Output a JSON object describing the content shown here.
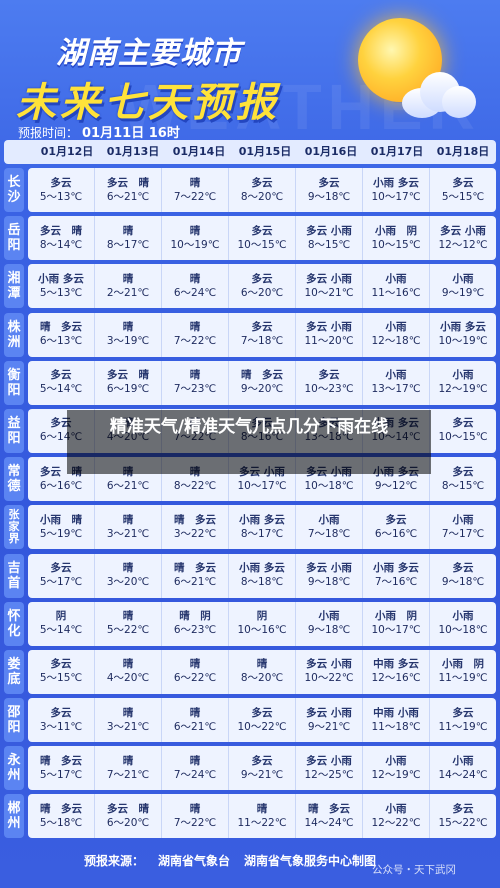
{
  "header": {
    "province": "湖南主要城市",
    "title": "未来七天预报",
    "bg_word": "WEATHER",
    "publish_label": "预报时间：",
    "publish_time": "01月11日 16时"
  },
  "dates": [
    "01月12日",
    "01月13日",
    "01月14日",
    "01月15日",
    "01月16日",
    "01月17日",
    "01月18日"
  ],
  "cities": [
    {
      "name": "长沙",
      "days": [
        {
          "c": "多云",
          "t": "5～13℃"
        },
        {
          "c": "多云　晴",
          "t": "6～21℃"
        },
        {
          "c": "晴",
          "t": "7～22℃"
        },
        {
          "c": "多云",
          "t": "8～20℃"
        },
        {
          "c": "多云",
          "t": "9～18℃"
        },
        {
          "c": "小雨 多云",
          "t": "10～17℃"
        },
        {
          "c": "多云",
          "t": "5～15℃"
        }
      ]
    },
    {
      "name": "岳阳",
      "days": [
        {
          "c": "多云　晴",
          "t": "8～14℃"
        },
        {
          "c": "晴",
          "t": "8～17℃"
        },
        {
          "c": "晴",
          "t": "10～19℃"
        },
        {
          "c": "多云",
          "t": "10～15℃"
        },
        {
          "c": "多云 小雨",
          "t": "8～15℃"
        },
        {
          "c": "小雨　阴",
          "t": "10～15℃"
        },
        {
          "c": "多云 小雨",
          "t": "12～12℃"
        }
      ]
    },
    {
      "name": "湘潭",
      "days": [
        {
          "c": "小雨 多云",
          "t": "5～13℃"
        },
        {
          "c": "晴",
          "t": "2～21℃"
        },
        {
          "c": "晴",
          "t": "6～24℃"
        },
        {
          "c": "多云",
          "t": "6～20℃"
        },
        {
          "c": "多云 小雨",
          "t": "10～21℃"
        },
        {
          "c": "小雨",
          "t": "11～16℃"
        },
        {
          "c": "小雨",
          "t": "9～19℃"
        }
      ]
    },
    {
      "name": "株洲",
      "days": [
        {
          "c": "晴　多云",
          "t": "6～13℃"
        },
        {
          "c": "晴",
          "t": "3～19℃"
        },
        {
          "c": "晴",
          "t": "7～22℃"
        },
        {
          "c": "多云",
          "t": "7～18℃"
        },
        {
          "c": "多云 小雨",
          "t": "11～20℃"
        },
        {
          "c": "小雨",
          "t": "12～18℃"
        },
        {
          "c": "小雨 多云",
          "t": "10～19℃"
        }
      ]
    },
    {
      "name": "衡阳",
      "days": [
        {
          "c": "多云",
          "t": "5～14℃"
        },
        {
          "c": "多云　晴",
          "t": "6～19℃"
        },
        {
          "c": "晴",
          "t": "7～23℃"
        },
        {
          "c": "晴　多云",
          "t": "9～20℃"
        },
        {
          "c": "多云",
          "t": "10～23℃"
        },
        {
          "c": "小雨",
          "t": "13～17℃"
        },
        {
          "c": "小雨",
          "t": "12～19℃"
        }
      ]
    },
    {
      "name": "益阳",
      "days": [
        {
          "c": "多云",
          "t": "6～14℃"
        },
        {
          "c": "晴",
          "t": "4～20℃"
        },
        {
          "c": "晴",
          "t": "7～22℃"
        },
        {
          "c": "多云",
          "t": "8～16℃"
        },
        {
          "c": "多云",
          "t": "13～18℃"
        },
        {
          "c": "小雨 多云",
          "t": "10～14℃"
        },
        {
          "c": "多云",
          "t": "10～15℃"
        }
      ]
    },
    {
      "name": "常德",
      "days": [
        {
          "c": "多云　晴",
          "t": "6～16℃"
        },
        {
          "c": "晴",
          "t": "6～21℃"
        },
        {
          "c": "晴",
          "t": "8～22℃"
        },
        {
          "c": "多云 小雨",
          "t": "10～17℃"
        },
        {
          "c": "多云 小雨",
          "t": "10～18℃"
        },
        {
          "c": "小雨 多云",
          "t": "9～12℃"
        },
        {
          "c": "多云",
          "t": "8～15℃"
        }
      ]
    },
    {
      "name": "张家界",
      "days": [
        {
          "c": "小雨　晴",
          "t": "5～19℃"
        },
        {
          "c": "晴",
          "t": "3～21℃"
        },
        {
          "c": "晴　多云",
          "t": "3～22℃"
        },
        {
          "c": "小雨 多云",
          "t": "8～17℃"
        },
        {
          "c": "小雨",
          "t": "7～18℃"
        },
        {
          "c": "多云",
          "t": "6～16℃"
        },
        {
          "c": "小雨",
          "t": "7～17℃"
        }
      ]
    },
    {
      "name": "吉首",
      "days": [
        {
          "c": "多云",
          "t": "5～17℃"
        },
        {
          "c": "晴",
          "t": "3～20℃"
        },
        {
          "c": "晴　多云",
          "t": "6～21℃"
        },
        {
          "c": "小雨 多云",
          "t": "8～18℃"
        },
        {
          "c": "多云 小雨",
          "t": "9～18℃"
        },
        {
          "c": "小雨 多云",
          "t": "7～16℃"
        },
        {
          "c": "多云",
          "t": "9～18℃"
        }
      ]
    },
    {
      "name": "怀化",
      "days": [
        {
          "c": "阴",
          "t": "5～14℃"
        },
        {
          "c": "晴",
          "t": "5～22℃"
        },
        {
          "c": "晴　阴",
          "t": "6～23℃"
        },
        {
          "c": "阴",
          "t": "10～16℃"
        },
        {
          "c": "小雨",
          "t": "9～18℃"
        },
        {
          "c": "小雨　阴",
          "t": "10～17℃"
        },
        {
          "c": "小雨",
          "t": "10～18℃"
        }
      ]
    },
    {
      "name": "娄底",
      "days": [
        {
          "c": "多云",
          "t": "5～15℃"
        },
        {
          "c": "晴",
          "t": "4～20℃"
        },
        {
          "c": "晴",
          "t": "6～22℃"
        },
        {
          "c": "晴",
          "t": "8～20℃"
        },
        {
          "c": "多云 小雨",
          "t": "10～22℃"
        },
        {
          "c": "中雨 多云",
          "t": "12～16℃"
        },
        {
          "c": "小雨　阴",
          "t": "11～19℃"
        }
      ]
    },
    {
      "name": "邵阳",
      "days": [
        {
          "c": "多云",
          "t": "3～11℃"
        },
        {
          "c": "晴",
          "t": "3～21℃"
        },
        {
          "c": "晴",
          "t": "6～21℃"
        },
        {
          "c": "多云",
          "t": "10～22℃"
        },
        {
          "c": "多云 小雨",
          "t": "9～21℃"
        },
        {
          "c": "中雨 小雨",
          "t": "11～18℃"
        },
        {
          "c": "多云",
          "t": "11～19℃"
        }
      ]
    },
    {
      "name": "永州",
      "days": [
        {
          "c": "晴　多云",
          "t": "5～17℃"
        },
        {
          "c": "晴",
          "t": "7～21℃"
        },
        {
          "c": "晴",
          "t": "7～24℃"
        },
        {
          "c": "多云",
          "t": "9～21℃"
        },
        {
          "c": "多云 小雨",
          "t": "12～25℃"
        },
        {
          "c": "小雨",
          "t": "12～19℃"
        },
        {
          "c": "小雨",
          "t": "14～24℃"
        }
      ]
    },
    {
      "name": "郴州",
      "days": [
        {
          "c": "晴　多云",
          "t": "5～18℃"
        },
        {
          "c": "多云　晴",
          "t": "6～20℃"
        },
        {
          "c": "晴",
          "t": "7～22℃"
        },
        {
          "c": "晴",
          "t": "11～22℃"
        },
        {
          "c": "晴　多云",
          "t": "14～24℃"
        },
        {
          "c": "小雨",
          "t": "12～22℃"
        },
        {
          "c": "多云",
          "t": "15～22℃"
        }
      ]
    }
  ],
  "overlay": {
    "text": "精准天气/精准天气几点几分下雨在线"
  },
  "footer": {
    "source_label": "预报来源：",
    "source1": "湖南省气象台",
    "source2": "湖南省气象服务中心制图",
    "watermark": "公众号・天下武冈"
  }
}
